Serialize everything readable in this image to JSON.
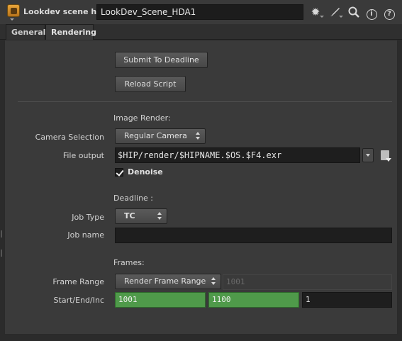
{
  "header": {
    "node_type_label": "Lookdev scene hda",
    "node_name": "LookDev_Scene_HDA1",
    "icons": [
      "hda-icon",
      "gear-icon",
      "brush-icon",
      "search-icon",
      "info-icon",
      "help-icon"
    ],
    "info_glyph": "i",
    "help_glyph": "?"
  },
  "tabs": [
    {
      "label": "General",
      "active": false
    },
    {
      "label": "Rendering",
      "active": true
    }
  ],
  "buttons": {
    "submit": "Submit To Deadline",
    "reload": "Reload Script"
  },
  "image_render": {
    "section_label": "Image Render:",
    "camera_label": "Camera Selection",
    "camera_value": "Regular Camera",
    "file_output_label": "File output",
    "file_output_value": "$HIP/render/$HIPNAME.$OS.$F4.exr",
    "denoise_label": "Denoise",
    "denoise_checked": true
  },
  "deadline": {
    "section_label": "Deadline :",
    "job_type_label": "Job Type",
    "job_type_value": "TC",
    "job_name_label": "Job name",
    "job_name_value": ""
  },
  "frames": {
    "section_label": "Frames:",
    "range_label": "Frame Range",
    "range_value": "Render Frame Range",
    "range_disabled_value": "1001",
    "start_end_inc_label": "Start/End/Inc",
    "start": "1001",
    "end": "1100",
    "inc": "1"
  },
  "colors": {
    "accent_green": "#4f9a4a",
    "panel_bg": "#3a3a3a",
    "field_bg": "#1e1e1e"
  }
}
